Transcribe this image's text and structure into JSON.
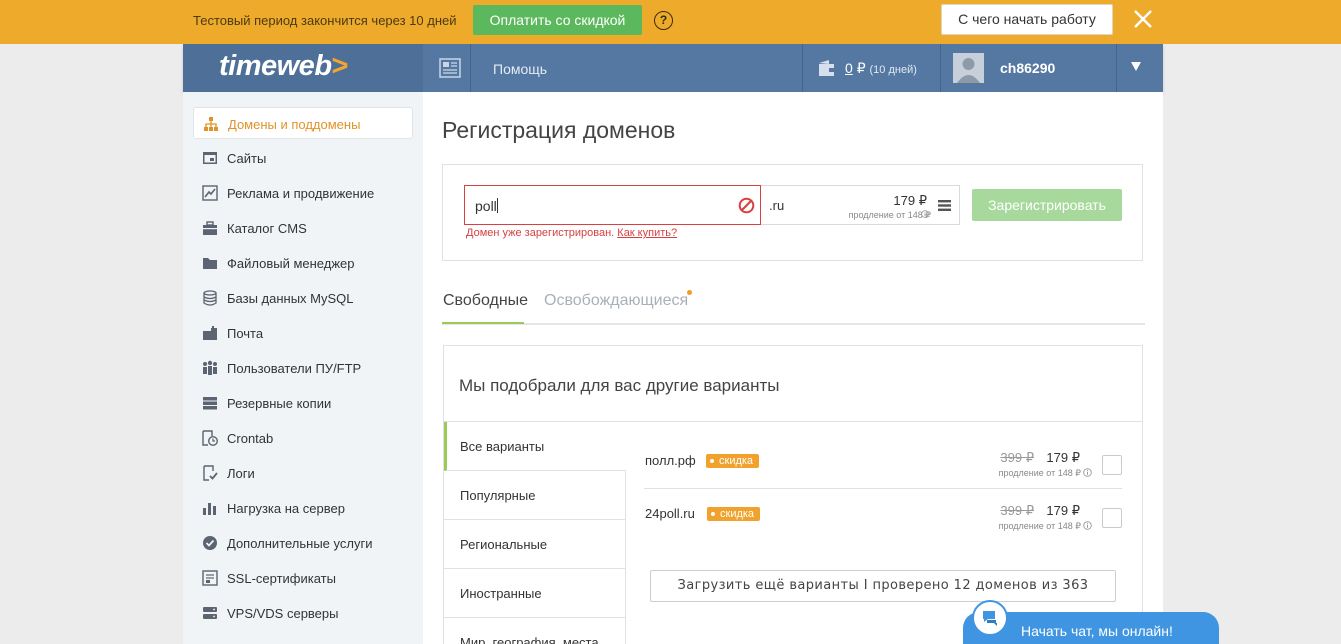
{
  "trial_banner": {
    "text": "Тестовый период закончится через 10 дней",
    "pay_button": "Оплатить со скидкой",
    "help_icon": "?",
    "start_button": "С чего начать работу"
  },
  "header": {
    "logo_text": "timeweb",
    "logo_arrow": ">",
    "help_link": "Помощь",
    "balance_amount": "0",
    "currency": "₽",
    "balance_days": "(10 дней)",
    "username": "ch86290"
  },
  "sidebar": {
    "items": [
      {
        "label": "Домены и поддомены",
        "icon": "domains-icon",
        "active": true
      },
      {
        "label": "Сайты",
        "icon": "sites-icon"
      },
      {
        "label": "Реклама и продвижение",
        "icon": "chart-icon"
      },
      {
        "label": "Каталог CMS",
        "icon": "briefcase-icon"
      },
      {
        "label": "Файловый менеджер",
        "icon": "folder-icon"
      },
      {
        "label": "Базы данных MySQL",
        "icon": "database-icon"
      },
      {
        "label": "Почта",
        "icon": "mail-icon"
      },
      {
        "label": "Пользователи ПУ/FTP",
        "icon": "users-icon"
      },
      {
        "label": "Резервные копии",
        "icon": "backup-icon"
      },
      {
        "label": "Crontab",
        "icon": "clock-icon"
      },
      {
        "label": "Логи",
        "icon": "log-icon"
      },
      {
        "label": "Нагрузка на сервер",
        "icon": "load-icon"
      },
      {
        "label": "Дополнительные услуги",
        "icon": "services-icon"
      },
      {
        "label": "SSL-сертификаты",
        "icon": "certificate-icon"
      },
      {
        "label": "VPS/VDS серверы",
        "icon": "server-icon"
      }
    ]
  },
  "main": {
    "title": "Регистрация доменов",
    "domain_input_value": "poll",
    "zone": ".ru",
    "zone_price": "179",
    "zone_renewal": "продление от 148",
    "register_button": "Зарегистрировать",
    "error_text": "Домен уже зарегистрирован.",
    "error_link": "Как купить?",
    "tabs": {
      "free": "Свободные",
      "releasing": "Освобождающиеся"
    },
    "suggestions": {
      "title": "Мы подобрали для вас другие варианты",
      "categories": [
        "Все варианты",
        "Популярные",
        "Региональные",
        "Иностранные",
        "Мир, география, места"
      ],
      "domains": [
        {
          "name": "полл.рф",
          "badge": "скидка",
          "old_price": "399",
          "new_price": "179",
          "renewal": "продление от 148"
        },
        {
          "name": "24poll.ru",
          "badge": "скидка",
          "old_price": "399",
          "new_price": "179",
          "renewal": "продление от 148"
        }
      ],
      "load_more": "Загрузить ещё варианты I проверено 12 доменов из 363"
    }
  },
  "chat": {
    "label": "Начать чат, мы онлайн!"
  },
  "colors": {
    "banner": "#eeab2b",
    "header": "#5578a3",
    "pay_green": "#5cb85c",
    "accent_orange": "#e0932a",
    "error_red": "#d94040",
    "chat_blue": "#3f95e2"
  }
}
